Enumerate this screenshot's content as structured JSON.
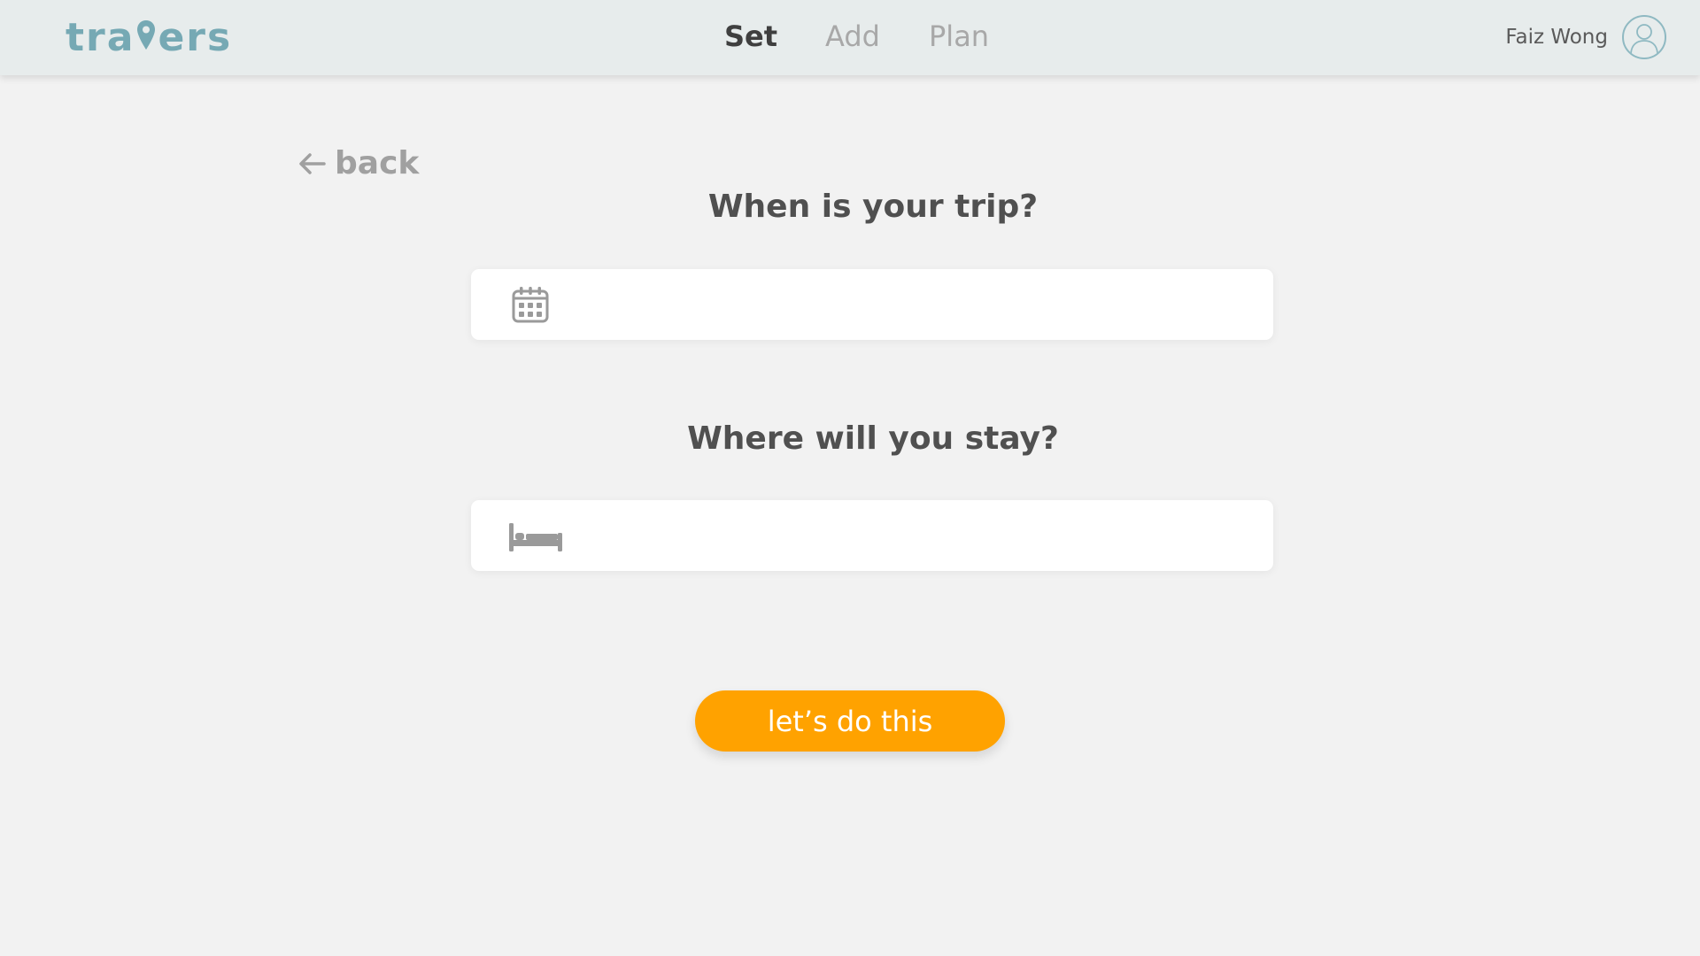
{
  "app": {
    "logo_prefix": "tra",
    "logo_suffix": "ers",
    "brand_color": "#76a9b4"
  },
  "nav": {
    "tabs": [
      {
        "label": "Set",
        "active": true
      },
      {
        "label": "Add",
        "active": false
      },
      {
        "label": "Plan",
        "active": false
      }
    ]
  },
  "user": {
    "name": "Faiz Wong",
    "avatar_icon": "user-outline-icon"
  },
  "back": {
    "label": "back",
    "icon": "arrow-left-icon"
  },
  "form": {
    "trip_question": "When is your trip?",
    "trip_value": "",
    "trip_icon": "calendar-icon",
    "stay_question": "Where will you stay?",
    "stay_value": "",
    "stay_icon": "bed-icon"
  },
  "cta": {
    "label": "let’s do this",
    "color": "#ffa200"
  }
}
